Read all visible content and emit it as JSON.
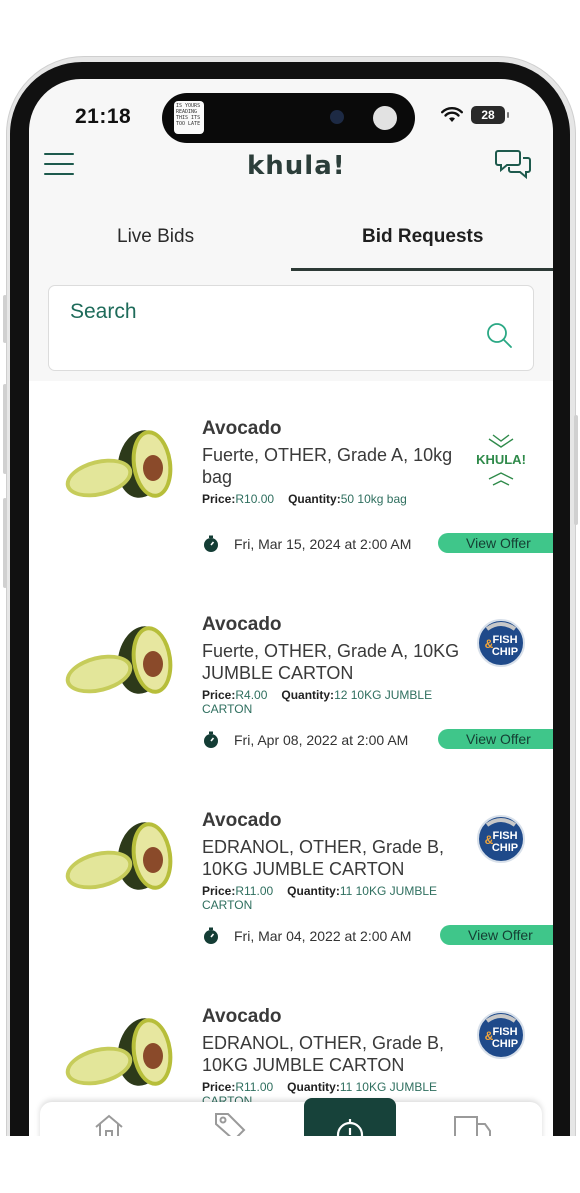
{
  "status": {
    "time": "21:18",
    "battery": "28",
    "island_note": "IS YOURS READING THIS ITS TOO LATE"
  },
  "app": {
    "logo": "khula!"
  },
  "tabs": [
    {
      "label": "Live Bids"
    },
    {
      "label": "Bid Requests"
    }
  ],
  "search": {
    "label": "Search"
  },
  "offers": [
    {
      "title": "Avocado",
      "desc": "Fuerte, OTHER, Grade A, 10kg bag",
      "price_label": "Price:",
      "price": "R10.00",
      "qty_label": "Quantity:",
      "qty": "50 10kg bag",
      "date": "Fri, Mar 15, 2024 at 2:00 AM",
      "button": "View Offer",
      "seller": "khula"
    },
    {
      "title": "Avocado",
      "desc": "Fuerte, OTHER, Grade A, 10KG JUMBLE CARTON",
      "price_label": "Price:",
      "price": "R4.00",
      "qty_label": "Quantity:",
      "qty": "12 10KG JUMBLE CARTON",
      "date": "Fri, Apr 08, 2022 at 2:00 AM",
      "button": "View Offer",
      "seller": "fish-chip"
    },
    {
      "title": "Avocado",
      "desc": "EDRANOL, OTHER, Grade B, 10KG JUMBLE CARTON",
      "price_label": "Price:",
      "price": "R11.00",
      "qty_label": "Quantity:",
      "qty": "11 10KG JUMBLE CARTON",
      "date": "Fri, Mar 04, 2022 at 2:00 AM",
      "button": "View Offer",
      "seller": "fish-chip"
    },
    {
      "title": "Avocado",
      "desc": "EDRANOL, OTHER, Grade B, 10KG JUMBLE CARTON",
      "price_label": "Price:",
      "price": "R11.00",
      "qty_label": "Quantity:",
      "qty": "11 10KG JUMBLE CARTON",
      "seller": "fish-chip"
    }
  ],
  "seller_logos": {
    "khula": "KHULA!",
    "fish_top": "FISH",
    "fish_amp": "&",
    "fish_bottom": "CHIP"
  },
  "colors": {
    "accent": "#3fc68a",
    "brand": "#17423a",
    "link": "#1e6b5a"
  },
  "icons": {
    "menu": "hamburger-icon",
    "chat": "chat-bubbles-icon",
    "search": "search-icon",
    "timer": "stopwatch-icon",
    "home": "home-icon",
    "tag": "tag-icon",
    "truck": "truck-icon"
  }
}
